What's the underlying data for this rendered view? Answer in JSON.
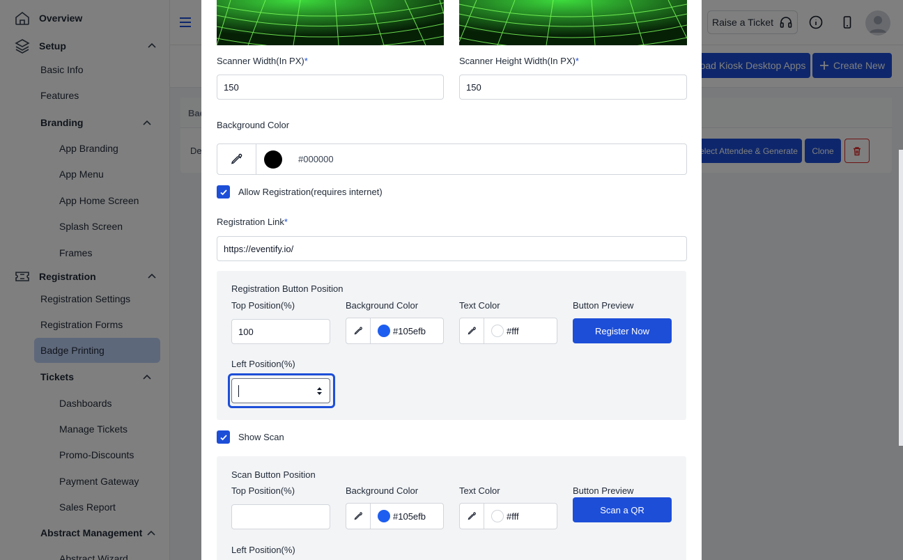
{
  "sidebar": {
    "overview": "Overview",
    "setup": "Setup",
    "basic_info": "Basic Info",
    "features": "Features",
    "branding": "Branding",
    "app_branding": "App Branding",
    "app_menu": "App Menu",
    "app_home_screen": "App Home Screen",
    "splash_screen": "Splash Screen",
    "frames": "Frames",
    "registration": "Registration",
    "registration_settings": "Registration Settings",
    "registration_forms": "Registration Forms",
    "badge_printing": "Badge Printing",
    "tickets": "Tickets",
    "dashboards": "Dashboards",
    "manage_tickets": "Manage Tickets",
    "promo_discounts": "Promo-Discounts",
    "payment_gateway": "Payment Gateway",
    "sales_report": "Sales Report",
    "abstract_management": "Abstract Management",
    "abstract_wizard": "Abstract Wizard"
  },
  "header": {
    "raise_ticket": "Raise a Ticket"
  },
  "toolbar": {
    "download_apps": "oad Kiosk Desktop Apps",
    "create_new": "Create New"
  },
  "table": {
    "head_partial": "Bad",
    "row_partial": "De",
    "select_generate": "elect Attendee & Generate",
    "clone": "Clone"
  },
  "modal": {
    "scanner_width_label": "Scanner Width(In PX)",
    "scanner_width_value": "150",
    "scanner_height_label": "Scanner Height Width(In PX)",
    "scanner_height_value": "150",
    "required_mark": "*",
    "background_color_label": "Background Color",
    "background_color_value": "#000000",
    "background_swatch": "#000000",
    "allow_registration_label": "Allow Registration(requires internet)",
    "registration_link_label": "Registration Link",
    "registration_link_value": "https://eventify.io/",
    "reg_panel": {
      "title": "Registration Button Position",
      "top_label": "Top Position(%)",
      "top_value": "100",
      "bg_label": "Background Color",
      "bg_value": "#105efb",
      "text_label": "Text Color",
      "text_value": "#fff",
      "preview_label": "Button Preview",
      "preview_button": "Register Now",
      "left_label": "Left Position(%)",
      "left_value": ""
    },
    "show_scan_label": "Show Scan",
    "scan_panel": {
      "title": "Scan Button Position",
      "top_label": "Top Position(%)",
      "top_value": "",
      "bg_label": "Background Color",
      "bg_value": "#105efb",
      "text_label": "Text Color",
      "text_value": "#fff",
      "preview_label": "Button Preview",
      "preview_button": "Scan a QR",
      "left_label": "Left Position(%)"
    }
  },
  "colors": {
    "accent": "#1d4ed8",
    "swatch_blue": "#105efb",
    "swatch_white": "#ffffff"
  }
}
